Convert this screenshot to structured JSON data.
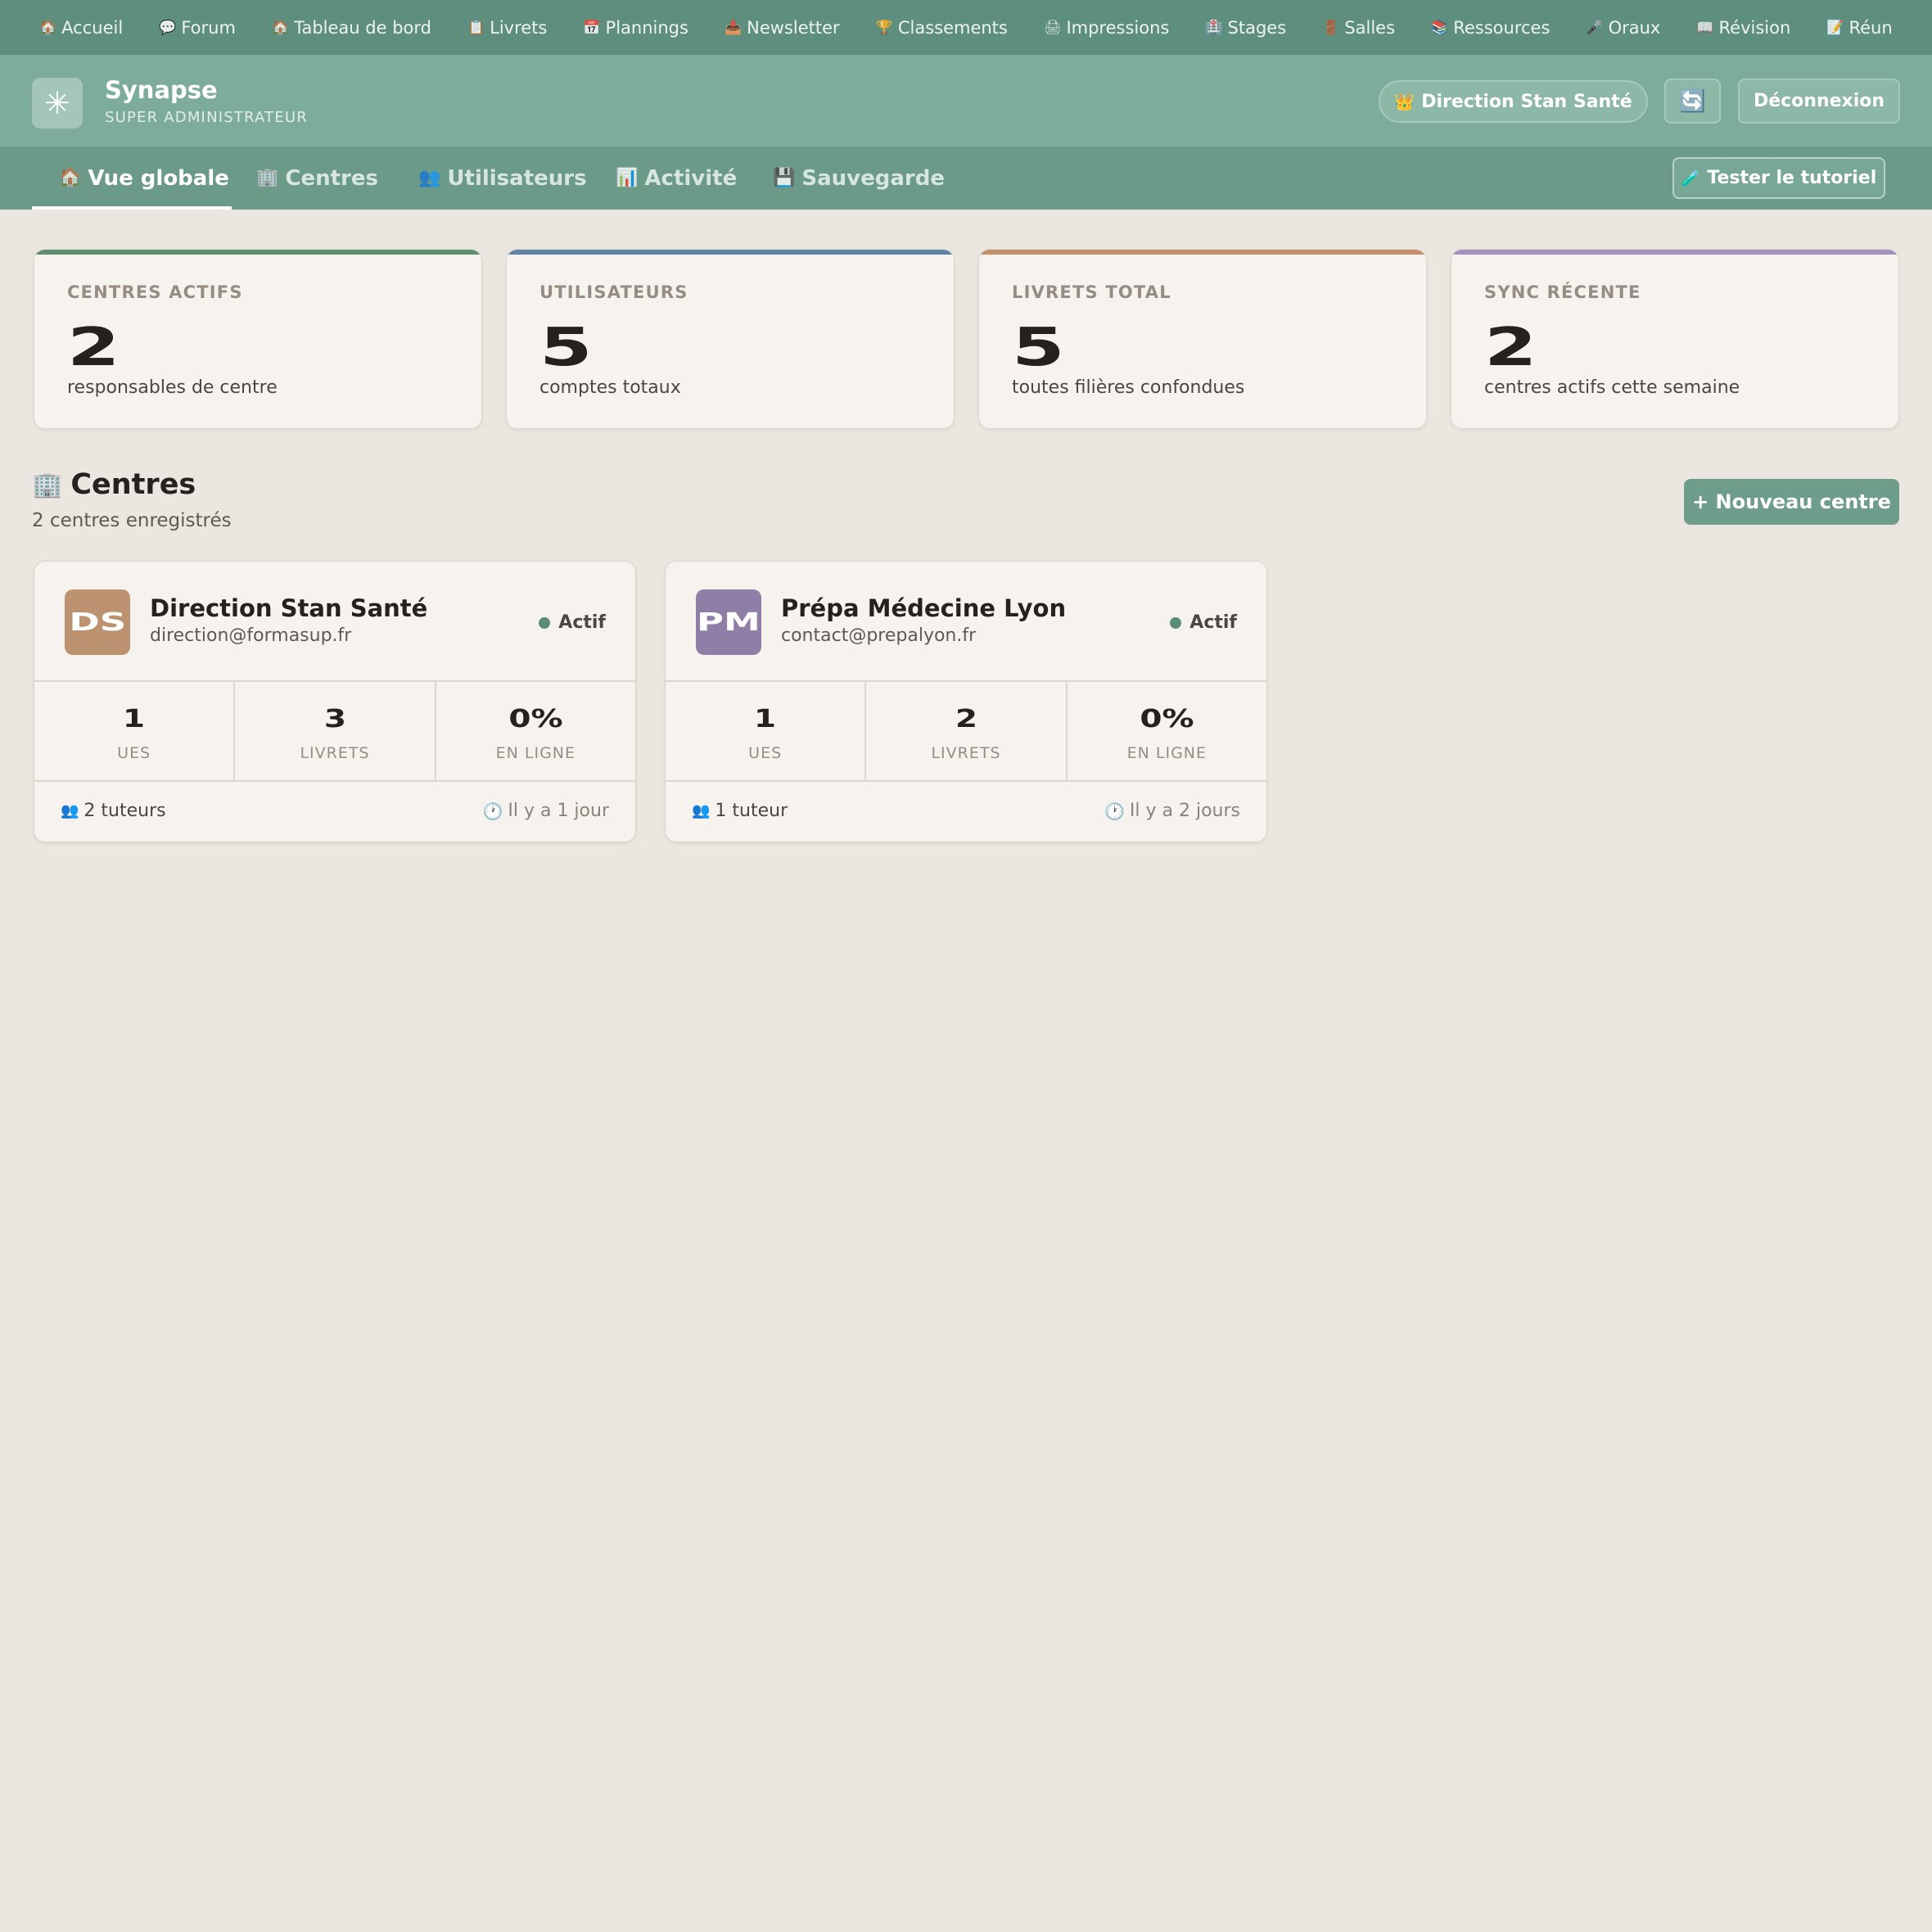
{
  "topnav": {
    "items": [
      {
        "icon": "🏠",
        "label": "Accueil"
      },
      {
        "icon": "💬",
        "label": "Forum"
      },
      {
        "icon": "🏠",
        "label": "Tableau de bord"
      },
      {
        "icon": "📋",
        "label": "Livrets"
      },
      {
        "icon": "📅",
        "label": "Plannings"
      },
      {
        "icon": "📤",
        "label": "Newsletter"
      },
      {
        "icon": "🏆",
        "label": "Classements"
      },
      {
        "icon": "🖨",
        "label": "Impressions"
      },
      {
        "icon": "🏥",
        "label": "Stages"
      },
      {
        "icon": "🚪",
        "label": "Salles"
      },
      {
        "icon": "📚",
        "label": "Ressources"
      },
      {
        "icon": "🎤",
        "label": "Oraux"
      },
      {
        "icon": "📖",
        "label": "Révision"
      },
      {
        "icon": "📝",
        "label": "Réun"
      }
    ]
  },
  "appbar": {
    "logo_glyph": "✳",
    "title": "Synapse",
    "subtitle": "SUPER ADMINISTRATEUR",
    "center_icon": "👑",
    "center_label": "Direction Stan Santé",
    "sync_icon": "🔄",
    "logout_label": "Déconnexion"
  },
  "tabs": {
    "items": [
      {
        "icon": "🏠",
        "label": "Vue globale",
        "active": true
      },
      {
        "icon": "🏢",
        "label": "Centres",
        "active": false
      },
      {
        "icon": "👥",
        "label": "Utilisateurs",
        "active": false
      },
      {
        "icon": "📊",
        "label": "Activité",
        "active": false
      },
      {
        "icon": "💾",
        "label": "Sauvegarde",
        "active": false
      }
    ],
    "tutorial_icon": "🧪",
    "tutorial_label": "Tester le tutoriel"
  },
  "stats": [
    {
      "label": "CENTRES ACTIFS",
      "value": "2",
      "desc": "responsables de centre",
      "color": "#5e8e6e"
    },
    {
      "label": "UTILISATEURS",
      "value": "5",
      "desc": "comptes totaux",
      "color": "#5f84a6"
    },
    {
      "label": "LIVRETS TOTAL",
      "value": "5",
      "desc": "toutes filières confondues",
      "color": "#c49069"
    },
    {
      "label": "SYNC RÉCENTE",
      "value": "2",
      "desc": "centres actifs cette semaine",
      "color": "#a392c1"
    }
  ],
  "centres_section": {
    "icon": "🏢",
    "title": "Centres",
    "subtitle": "2 centres enregistrés",
    "new_button": "+ Nouveau centre"
  },
  "centres": [
    {
      "initials": "DS",
      "avatar_color": "#bd9270",
      "name": "Direction Stan Santé",
      "email": "direction@formasup.fr",
      "status": "Actif",
      "metrics": [
        {
          "value": "1",
          "label": "UES"
        },
        {
          "value": "3",
          "label": "LIVRETS"
        },
        {
          "value": "0%",
          "label": "EN LIGNE"
        }
      ],
      "tutors_icon": "👥",
      "tutors": "2 tuteurs",
      "last_icon": "🕐",
      "last": "Il y a 1 jour"
    },
    {
      "initials": "PM",
      "avatar_color": "#8f7fa6",
      "name": "Prépa Médecine Lyon",
      "email": "contact@prepalyon.fr",
      "status": "Actif",
      "metrics": [
        {
          "value": "1",
          "label": "UES"
        },
        {
          "value": "2",
          "label": "LIVRETS"
        },
        {
          "value": "0%",
          "label": "EN LIGNE"
        }
      ],
      "tutors_icon": "👥",
      "tutors": "1 tuteur",
      "last_icon": "🕐",
      "last": "Il y a 2 jours"
    }
  ]
}
